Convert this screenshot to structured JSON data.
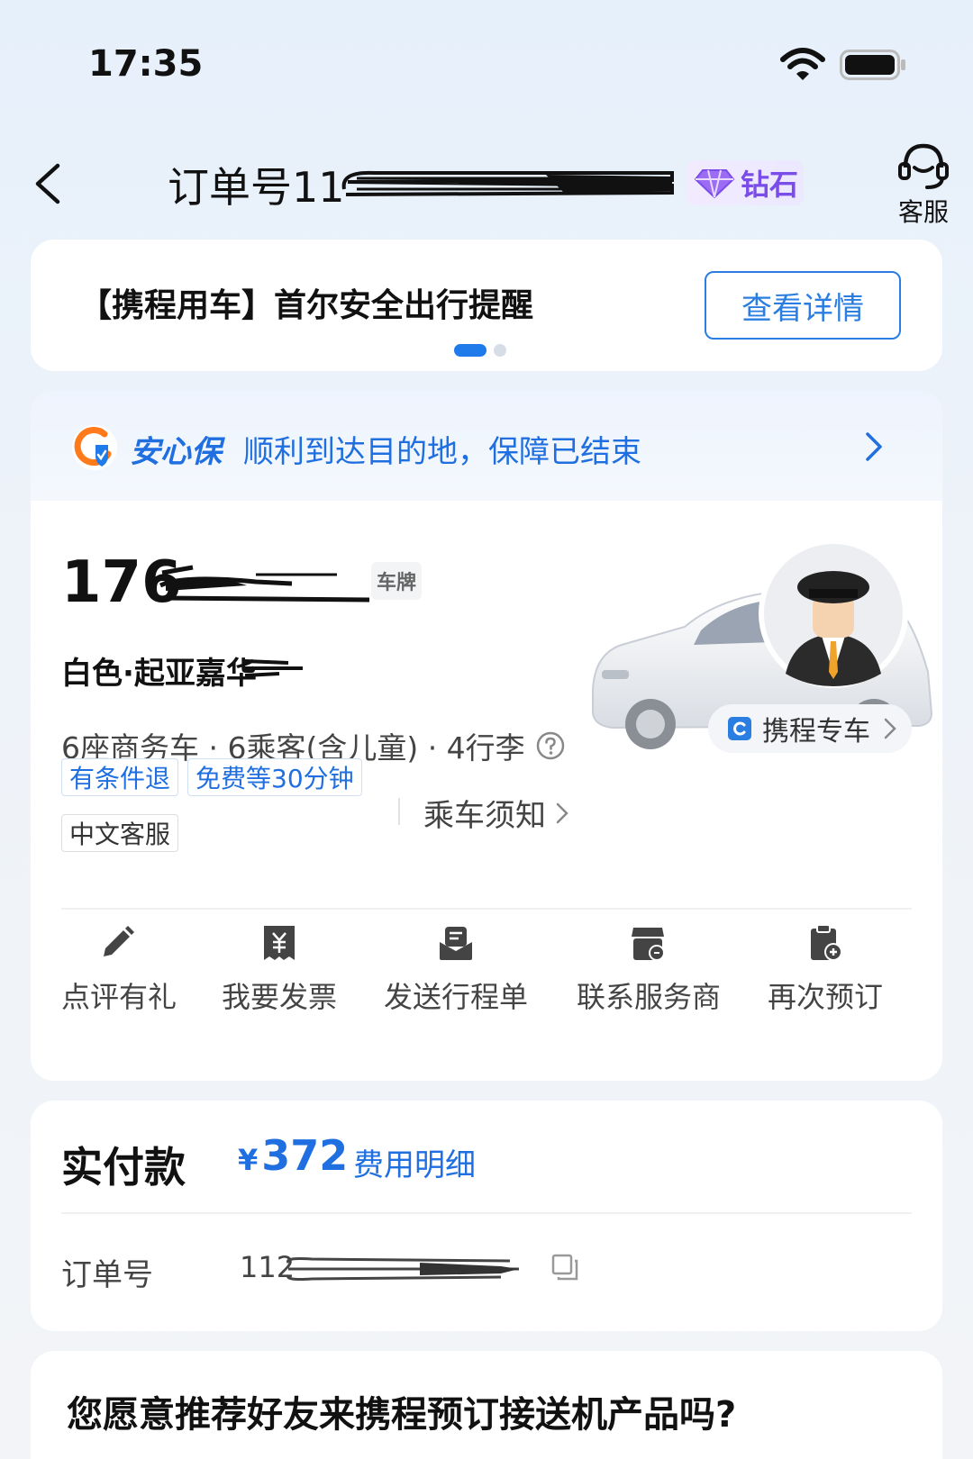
{
  "status_bar": {
    "time": "17:35"
  },
  "nav": {
    "title": "订单号11",
    "level_badge": "钻石",
    "service_label": "客服"
  },
  "notice": {
    "text": "【携程用车】首尔安全出行提醒",
    "button_label": "查看详情",
    "page_count": 2,
    "active_page": 1
  },
  "insurance": {
    "brand": "安心保",
    "message": "顺利到达目的地，保障已结束"
  },
  "vehicle": {
    "plate_prefix": "176",
    "plate_tag": "车牌",
    "description": "白色·起亚嘉华",
    "spec": "6座商务车 · 6乘客(含儿童) · 4行李",
    "service_tag": "携程专车",
    "tags": [
      "有条件退",
      "免费等30分钟",
      "中文客服"
    ],
    "rules_link": "乘车须知"
  },
  "actions": [
    {
      "label": "点评有礼",
      "icon": "pencil-icon"
    },
    {
      "label": "我要发票",
      "icon": "invoice-icon"
    },
    {
      "label": "发送行程单",
      "icon": "itinerary-icon"
    },
    {
      "label": "联系服务商",
      "icon": "shop-contact-icon"
    },
    {
      "label": "再次预订",
      "icon": "rebook-icon"
    }
  ],
  "payment": {
    "label": "实付款",
    "currency": "¥",
    "amount": "372",
    "fee_link": "费用明细",
    "order_label": "订单号",
    "order_value": "112"
  },
  "recommend": {
    "question": "您愿意推荐好友来携程预订接送机产品吗?"
  },
  "colors": {
    "accent": "#1f6fe0",
    "diamond": "#7a4de8",
    "background": "#eef3f9"
  }
}
